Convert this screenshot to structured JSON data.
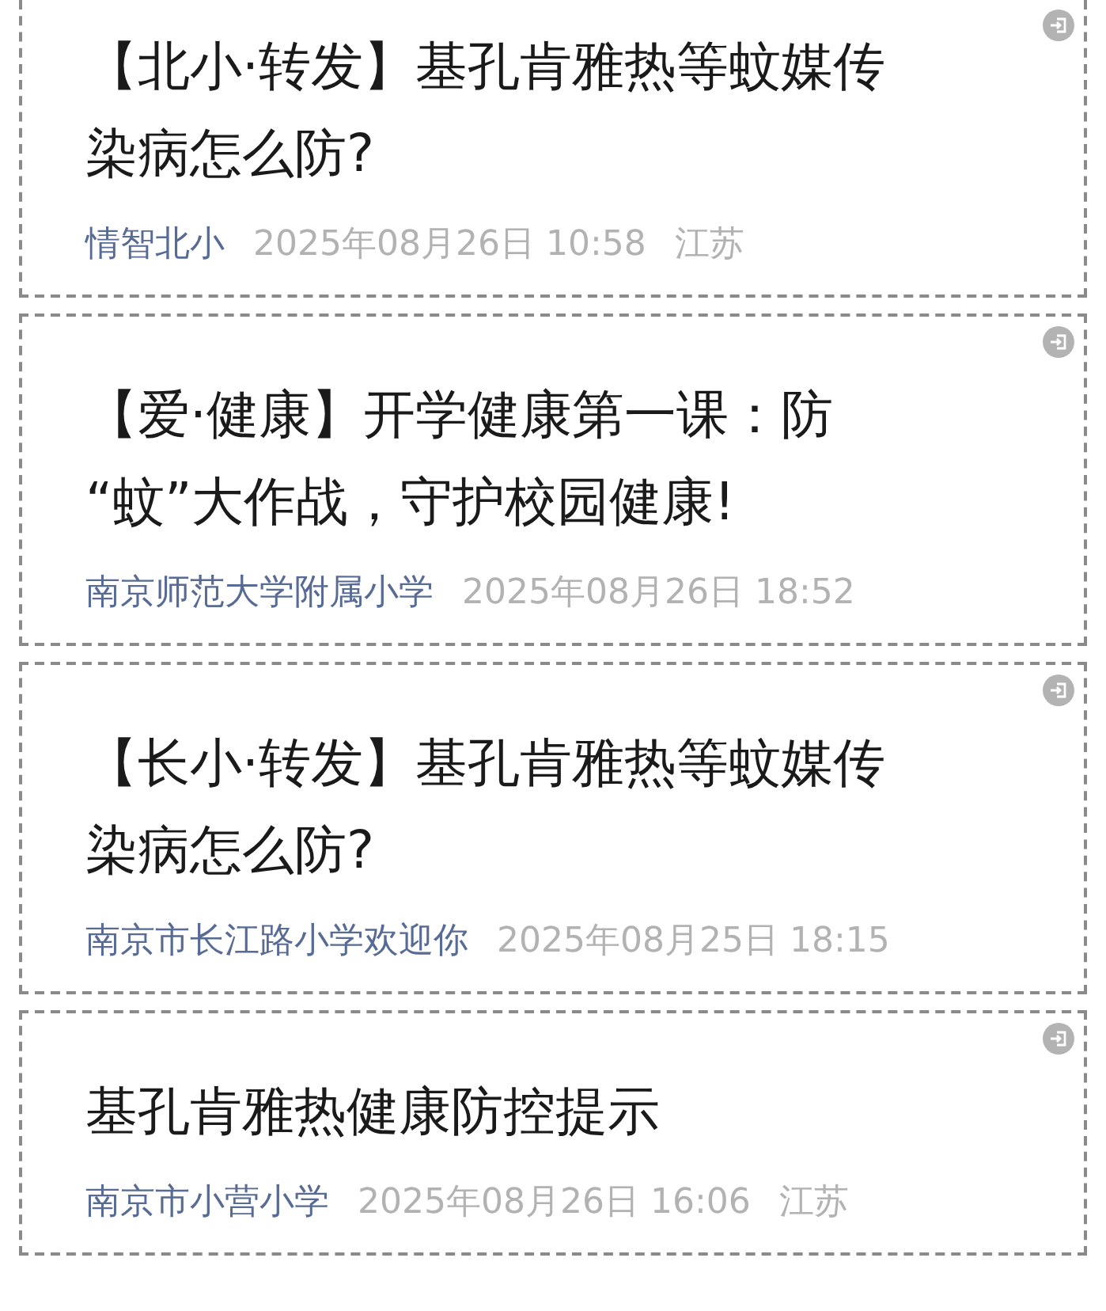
{
  "articles": [
    {
      "title_lines": [
        "【北小·转发】基孔肯雅热等蚊媒传",
        "染病怎么防?"
      ],
      "source": "情智北小",
      "time": "2025年08月26日 10:58",
      "location": "江苏"
    },
    {
      "title_lines": [
        "【爱·健康】开学健康第一课：防",
        "“蚊”大作战，守护校园健康!"
      ],
      "source": "南京师范大学附属小学",
      "time": "2025年08月26日 18:52"
    },
    {
      "title_lines": [
        "【长小·转发】基孔肯雅热等蚊媒传",
        "染病怎么防?"
      ],
      "source": "南京市长江路小学欢迎你",
      "time": "2025年08月25日 18:15"
    },
    {
      "title_lines": [
        "基孔肯雅热健康防控提示"
      ],
      "source": "南京市小营小学",
      "time": "2025年08月26日 16:06",
      "location": "江苏"
    }
  ]
}
